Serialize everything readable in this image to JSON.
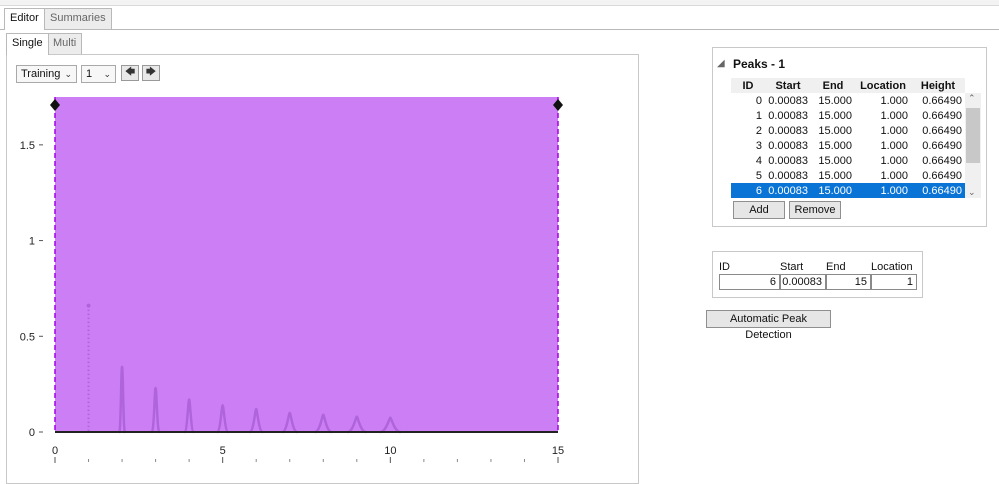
{
  "tabs": {
    "editor": "Editor",
    "summaries": "Summaries"
  },
  "subtabs": {
    "single": "Single",
    "multi": "Multi"
  },
  "toolbar": {
    "mode_value": "Training",
    "index_value": "1",
    "prev_icon": "arrow-left-icon",
    "next_icon": "arrow-right-icon"
  },
  "peaks": {
    "title": "Peaks - 1",
    "columns": [
      "ID",
      "Start",
      "End",
      "Location",
      "Height"
    ],
    "rows": [
      [
        "0",
        "0.00083",
        "15.000",
        "1.000",
        "0.66490"
      ],
      [
        "1",
        "0.00083",
        "15.000",
        "1.000",
        "0.66490"
      ],
      [
        "2",
        "0.00083",
        "15.000",
        "1.000",
        "0.66490"
      ],
      [
        "3",
        "0.00083",
        "15.000",
        "1.000",
        "0.66490"
      ],
      [
        "4",
        "0.00083",
        "15.000",
        "1.000",
        "0.66490"
      ],
      [
        "5",
        "0.00083",
        "15.000",
        "1.000",
        "0.66490"
      ],
      [
        "6",
        "0.00083",
        "15.000",
        "1.000",
        "0.66490"
      ]
    ],
    "selected_row": 6,
    "add_label": "Add",
    "remove_label": "Remove"
  },
  "entry": {
    "headers": {
      "id": "ID",
      "start": "Start",
      "end": "End",
      "location": "Location"
    },
    "values": {
      "id": "6",
      "start": "0.00083",
      "end": "15",
      "location": "1"
    }
  },
  "auto_detect_label": "Automatic Peak Detection",
  "colors": {
    "region_fill": "#cc7ff5",
    "region_border": "#a300e6",
    "peak_line": "#b064dc",
    "selection": "#0a74d6"
  },
  "chart_data": {
    "type": "line",
    "x_range": [
      0,
      15
    ],
    "y_range": [
      0,
      1.75
    ],
    "x_ticks": [
      "0",
      "5",
      "10",
      "15"
    ],
    "x_tick_values": [
      0,
      5,
      10,
      15
    ],
    "y_ticks": [
      "0",
      "0.5",
      "1",
      "1.5"
    ],
    "y_tick_values": [
      0,
      0.5,
      1,
      1.5
    ],
    "selected_region": {
      "start": 0,
      "end": 15
    },
    "peaks": [
      {
        "x": 1,
        "y": 0.66
      },
      {
        "x": 2,
        "y": 0.34
      },
      {
        "x": 3,
        "y": 0.23
      },
      {
        "x": 4,
        "y": 0.17
      },
      {
        "x": 5,
        "y": 0.14
      },
      {
        "x": 6,
        "y": 0.12
      },
      {
        "x": 7,
        "y": 0.1
      },
      {
        "x": 8,
        "y": 0.09
      },
      {
        "x": 9,
        "y": 0.08
      },
      {
        "x": 10,
        "y": 0.075
      }
    ]
  }
}
